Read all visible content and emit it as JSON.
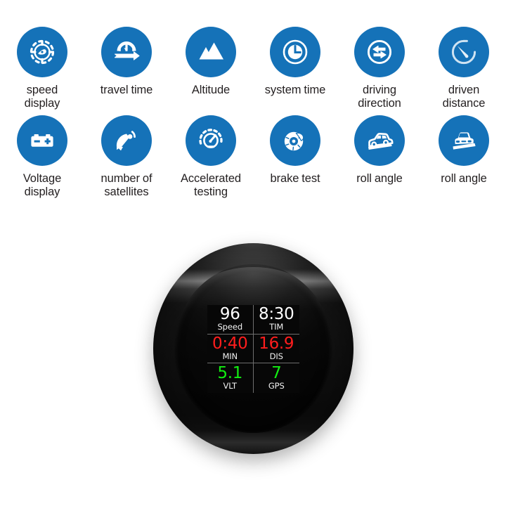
{
  "features": {
    "rows": [
      [
        {
          "icon": "speedometer-icon",
          "label": "speed\ndisplay"
        },
        {
          "icon": "travel-time-icon",
          "label": "travel time"
        },
        {
          "icon": "mountain-altitude-icon",
          "label": "Altitude"
        },
        {
          "icon": "clock-icon",
          "label": "system time"
        },
        {
          "icon": "two-way-arrow-icon",
          "label": "driving\ndirection"
        },
        {
          "icon": "odometer-needle-icon",
          "label": "driven\ndistance"
        }
      ],
      [
        {
          "icon": "car-battery-icon",
          "label": "Voltage\ndisplay"
        },
        {
          "icon": "satellite-dish-icon",
          "label": "number of\nsatellites"
        },
        {
          "icon": "acceleration-gauge-icon",
          "label": "Accelerated\ntesting"
        },
        {
          "icon": "brake-disc-icon",
          "label": "brake test"
        },
        {
          "icon": "car-side-slope-icon",
          "label": "roll angle"
        },
        {
          "icon": "car-front-slope-icon",
          "label": "roll angle"
        }
      ]
    ]
  },
  "device": {
    "name": "round-hud-gauge",
    "lcd": {
      "cells": [
        {
          "value": "96",
          "unit": "Speed",
          "color": "white"
        },
        {
          "value": "8:30",
          "unit": "TIM",
          "color": "white"
        },
        {
          "value": "0:40",
          "unit": "MIN",
          "color": "red"
        },
        {
          "value": "16.9",
          "unit": "DIS",
          "color": "red"
        },
        {
          "value": "5.1",
          "unit": "VLT",
          "color": "green"
        },
        {
          "value": "7",
          "unit": "GPS",
          "color": "green"
        }
      ]
    }
  },
  "colors": {
    "icon_blue": "#1572b8",
    "label_text": "#231f20",
    "lcd_white": "#ffffff",
    "lcd_red": "#ff1d1d",
    "lcd_green": "#12ee12",
    "page_background": "#ffffff"
  }
}
